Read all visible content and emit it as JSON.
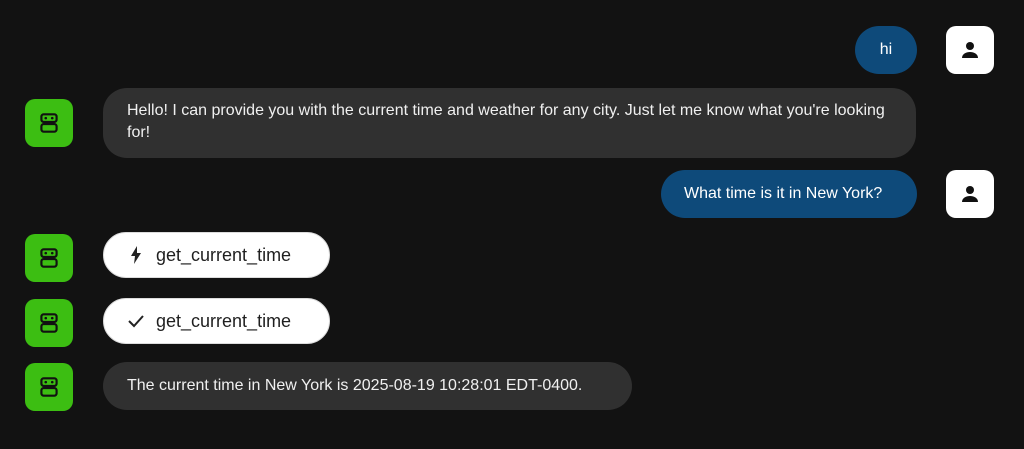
{
  "messages": [
    {
      "role": "user",
      "text": "hi"
    },
    {
      "role": "bot",
      "text": "Hello! I can provide you with the current time and weather for any city. Just let me know what you're looking for!"
    },
    {
      "role": "user",
      "text": "What time is it in New York?"
    },
    {
      "role": "bot",
      "type": "function_call",
      "icon": "bolt-icon",
      "text": "get_current_time"
    },
    {
      "role": "bot",
      "type": "function_response",
      "icon": "check-icon",
      "text": "get_current_time"
    },
    {
      "role": "bot",
      "text": "The current time in New York is 2025-08-19 10:28:01 EDT-0400."
    }
  ],
  "colors": {
    "background": "#121212",
    "user_bubble": "#0e4a7a",
    "bot_bubble": "#303030",
    "bot_avatar": "#3cbe12",
    "user_avatar": "#ffffff"
  }
}
